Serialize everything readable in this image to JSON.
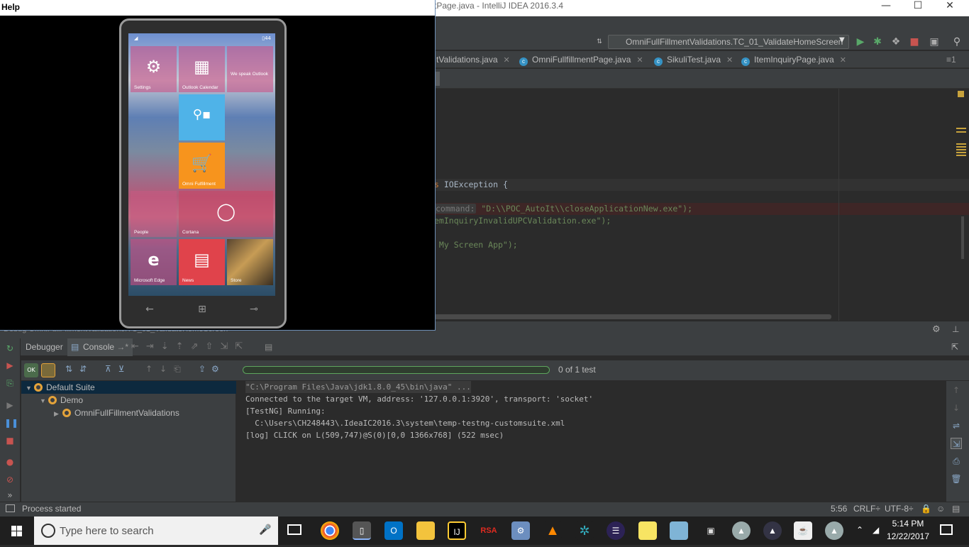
{
  "ide": {
    "title": "tPage.java - IntelliJ IDEA 2016.3.4",
    "run_config": "OmniFullFillmentValidations.TC_01_ValidateHomeScreen",
    "tabs": [
      {
        "label": "tValidations.java"
      },
      {
        "label": "OmniFullfillmentPage.java"
      },
      {
        "label": "SikuliTest.java"
      },
      {
        "label": "ItemInquiryPage.java"
      }
    ],
    "tabs_overflow": "≡1",
    "code": {
      "line1_kw": "s",
      "line1_rest": " IOException {",
      "line2_hint": "command:",
      "line2_str": " \"D:\\\\POC_AutoIt\\\\closeApplicationNew.exe\");",
      "line3": "emInquiryInvalidUPCValidation.exe\");",
      "line4_str": " My Screen App\");"
    }
  },
  "emulator": {
    "menu_help": "Help",
    "tiles": [
      {
        "label": "Settings",
        "icon": "⚙"
      },
      {
        "label": "Outlook Calendar",
        "icon": "▦"
      },
      {
        "label": "We speak Outlook",
        "icon": ""
      },
      {
        "label": "",
        "icon": "⚲▪"
      },
      {
        "label": "Omni Fulfillment",
        "icon": "🛒"
      },
      {
        "label": "People",
        "icon": ""
      },
      {
        "label": "Cortana",
        "icon": "◯"
      },
      {
        "label": "Microsoft Edge",
        "icon": "e"
      },
      {
        "label": "News",
        "icon": "▤"
      },
      {
        "label": "Store",
        "icon": ""
      }
    ],
    "status_right": "▯44",
    "nav": {
      "back": "←",
      "home": "⊞",
      "search": "⊸"
    }
  },
  "debug": {
    "window_title": "Debug  OmniFullFillmentValidations.TC_01_ValidateHomeScreen",
    "tabs": {
      "debugger": "Debugger",
      "console": "Console"
    },
    "progress_fraction": 0,
    "progress_text": "0 of 1 test",
    "tree": {
      "suite": "Default Suite",
      "demo": "Demo",
      "class": "OmniFullFillmentValidations"
    },
    "console_lines": [
      "\"C:\\Program Files\\Java\\jdk1.8.0_45\\bin\\java\" ...",
      "Connected to the target VM, address: '127.0.0.1:3920', transport: 'socket'",
      "[TestNG] Running:",
      "  C:\\Users\\CH248443\\.IdeaIC2016.3\\system\\temp-testng-customsuite.xml",
      "[log] CLICK on L(509,747)@S(0)[0,0 1366x768] (522 msec)"
    ]
  },
  "statusbar": {
    "text": "Process started",
    "position": "5:56",
    "line_sep": "CRLF÷",
    "encoding": "UTF-8÷"
  },
  "taskbar": {
    "search_placeholder": "Type here to search",
    "time": "5:14 PM",
    "date": "12/22/2017",
    "apps": [
      {
        "name": "chrome",
        "label": ""
      },
      {
        "name": "phone-emulator",
        "label": ""
      },
      {
        "name": "outlook",
        "label": "O"
      },
      {
        "name": "file-explorer",
        "label": ""
      },
      {
        "name": "intellij",
        "label": "IJ"
      },
      {
        "name": "rsa",
        "label": "RSA"
      }
    ]
  },
  "colors": {
    "accent_tile_blue": "#4fb3e8",
    "accent_tile_orange": "#f7941d",
    "accent_tile_red": "#e0434b",
    "progress_green": "#5da55d"
  }
}
